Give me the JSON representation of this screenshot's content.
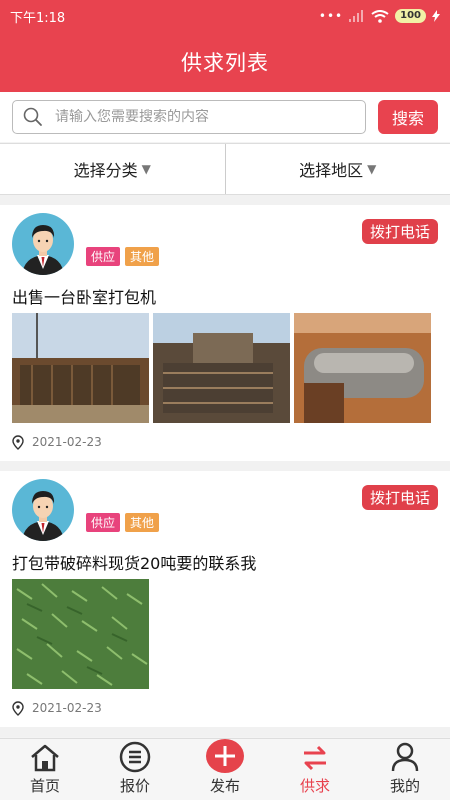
{
  "status": {
    "time": "下午1:18",
    "battery": "100"
  },
  "header": {
    "title": "供求列表"
  },
  "search": {
    "placeholder": "请输入您需要搜索的内容",
    "button": "搜索"
  },
  "filters": {
    "category": "选择分类",
    "region": "选择地区"
  },
  "posts": [
    {
      "tag_supply": "供应",
      "tag_other": "其他",
      "call": "拨打电话",
      "title": "出售一台卧室打包机",
      "date": "2021-02-23"
    },
    {
      "tag_supply": "供应",
      "tag_other": "其他",
      "call": "拨打电话",
      "title": "打包带破碎料现货20吨要的联系我",
      "date": "2021-02-23"
    }
  ],
  "tabs": [
    {
      "label": "首页",
      "icon": "home-icon"
    },
    {
      "label": "报价",
      "icon": "list-circle-icon"
    },
    {
      "label": "发布",
      "icon": "plus-circle-icon"
    },
    {
      "label": "供求",
      "icon": "swap-arrows-icon",
      "active": true
    },
    {
      "label": "我的",
      "icon": "user-icon"
    }
  ],
  "colors": {
    "primary": "#e8434f",
    "tag_supply": "#e8437c",
    "tag_other": "#f0a14a",
    "background": "#f3f3f3"
  }
}
